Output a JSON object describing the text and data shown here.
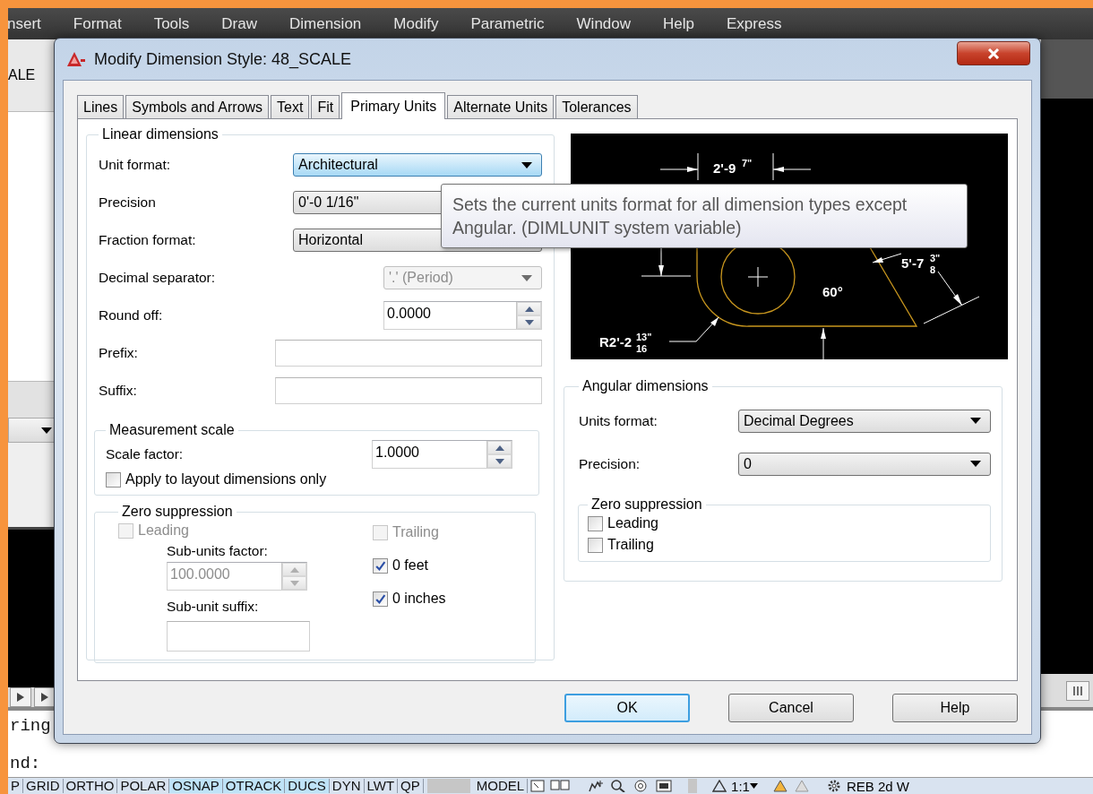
{
  "app": {
    "menu": [
      "nsert",
      "Format",
      "Tools",
      "Draw",
      "Dimension",
      "Modify",
      "Parametric",
      "Window",
      "Help",
      "Express"
    ],
    "panel_label": "ALE",
    "command_lines": [
      "ring",
      "nd:"
    ],
    "status_toggles": [
      {
        "label": "P",
        "on": false
      },
      {
        "label": "GRID",
        "on": false
      },
      {
        "label": "ORTHO",
        "on": false
      },
      {
        "label": "POLAR",
        "on": false
      },
      {
        "label": "OSNAP",
        "on": true
      },
      {
        "label": "OTRACK",
        "on": true
      },
      {
        "label": "DUCS",
        "on": true
      },
      {
        "label": "DYN",
        "on": false
      },
      {
        "label": "LWT",
        "on": false
      },
      {
        "label": "QP",
        "on": false
      }
    ],
    "status_space": "MODEL",
    "annotation_scale": "1:1",
    "workspace": "REB 2d W"
  },
  "dialog": {
    "title": "Modify Dimension Style: 48_SCALE",
    "tabs": [
      {
        "label": "Lines",
        "selected": false
      },
      {
        "label": "Symbols and Arrows",
        "selected": false
      },
      {
        "label": "Text",
        "selected": false
      },
      {
        "label": "Fit",
        "selected": false
      },
      {
        "label": "Primary Units",
        "selected": true
      },
      {
        "label": "Alternate Units",
        "selected": false
      },
      {
        "label": "Tolerances",
        "selected": false
      }
    ],
    "linear": {
      "title": "Linear dimensions",
      "rows": [
        {
          "kind": "select",
          "label": "Unit format:",
          "value": "Architectural",
          "focused": true,
          "disabled": false
        },
        {
          "kind": "select",
          "label": "Precision",
          "value": "0'-0 1/16\"",
          "focused": false,
          "disabled": false
        },
        {
          "kind": "select",
          "label": "Fraction format:",
          "value": "Horizontal",
          "focused": false,
          "disabled": false
        },
        {
          "kind": "select",
          "label": "Decimal separator:",
          "value": "'.' (Period)",
          "focused": false,
          "disabled": true
        },
        {
          "kind": "spinner",
          "label": "Round off:",
          "value": "0.0000",
          "focused": false,
          "disabled": false
        },
        {
          "kind": "text",
          "label": "Prefix:",
          "focused": false,
          "disabled": false
        },
        {
          "kind": "text",
          "label": "Suffix:",
          "focused": false,
          "disabled": false
        }
      ]
    },
    "measurement": {
      "title": "Measurement scale",
      "scale_label": "Scale factor:",
      "scale_value": "1.0000",
      "apply": {
        "label": "Apply to layout dimensions only",
        "checked": false,
        "disabled": false
      }
    },
    "zero": {
      "title": "Zero suppression",
      "leading": {
        "label": "Leading",
        "checked": false,
        "disabled": true
      },
      "subunits_label": "Sub-units factor:",
      "subunits_value": "100.0000",
      "suffix_label": "Sub-unit suffix:",
      "right": [
        {
          "label": "Trailing",
          "checked": false,
          "disabled": true
        },
        {
          "label": "0 feet",
          "checked": true,
          "disabled": false
        },
        {
          "label": "0 inches",
          "checked": true,
          "disabled": false
        }
      ]
    },
    "preview": {
      "labels": [
        {
          "whole": "2'-9",
          "num": "7\""
        },
        {
          "whole": "5'-7",
          "num": "3\"",
          "den": "8"
        },
        {
          "whole": "60°"
        },
        {
          "whole": "R2'-2",
          "num": "13\"",
          "den": "16"
        }
      ]
    },
    "angular": {
      "title": "Angular dimensions",
      "rows": [
        {
          "label": "Units format:",
          "value": "Decimal Degrees"
        },
        {
          "label": "Precision:",
          "value": "0"
        }
      ],
      "zero": {
        "title": "Zero suppression",
        "items": [
          {
            "label": "Leading",
            "checked": false,
            "disabled": false
          },
          {
            "label": "Trailing",
            "checked": false,
            "disabled": false
          }
        ]
      }
    },
    "tooltip": "Sets the current units format for all dimension types except Angular. (DIMLUNIT system variable)",
    "buttons": [
      {
        "label": "OK",
        "default": true
      },
      {
        "label": "Cancel",
        "default": false
      },
      {
        "label": "Help",
        "default": false
      }
    ]
  }
}
